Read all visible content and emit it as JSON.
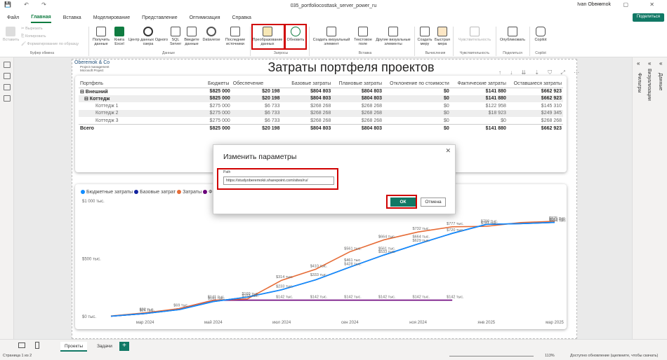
{
  "window": {
    "title": "035_portfoliocosttask_server_power_ru",
    "user": "Ivan Oberemok",
    "controls": "— ▢ ✕",
    "quick_access": "💾 ↶ ↷"
  },
  "menu": {
    "items": [
      "Файл",
      "Главная",
      "Вставка",
      "Моделирование",
      "Представление",
      "Оптимизация",
      "Справка"
    ],
    "share": "Поделиться"
  },
  "ribbon": {
    "buttons": {
      "paste": "Вставить",
      "cut": "Вырезать",
      "copy": "Копировать",
      "format": "Форматирование по образцу",
      "get_data": "Получить данные",
      "excel": "Книга Excel",
      "datahub": "Центр данных Одного озера",
      "sql": "SQL Server",
      "enter_data": "Введите данные",
      "dataverse": "Dataverse",
      "recent": "Последние источники",
      "transform": "Преобразование данных",
      "refresh": "Обновить",
      "new_visual": "Создать визуальный элемент",
      "textbox": "Текстовое поле",
      "more_visuals": "Другие визуальные элементы",
      "new_measure": "Создать меру",
      "quick_measure": "Быстрая мера",
      "sensitivity": "Чувствительность",
      "publish": "Опубликовать",
      "copilot": "Copilot"
    },
    "groups": {
      "clipboard": "Буфер обмена",
      "data": "Данные",
      "queries": "Запросы",
      "insert": "Вставка",
      "calculations": "Вычисления",
      "sensitivity": "Чувствительность",
      "share": "Поделиться",
      "copilot": "Copilot"
    }
  },
  "panes": {
    "filters": "Фильтры",
    "visualizations": "Визуализации",
    "data": "Данные"
  },
  "report": {
    "logo": {
      "company": "Oberemok & Co",
      "line1": "Project management",
      "line2": "Microsoft Project"
    },
    "title": "Затраты портфеля проектов",
    "visual_icons": "↑ ↓ ⇊ ⇣ ⛉ ⤢ ⋯"
  },
  "table": {
    "headers": [
      "Портфель",
      "Бюджеты",
      "Обеспечение",
      "Базовые затраты",
      "Плановые затраты",
      "Отклонение по стоимости",
      "Фактические затраты",
      "Оставшиеся затраты"
    ],
    "rows": [
      {
        "label": "⊟ Внешний",
        "cells": [
          "$825 000",
          "$20 198",
          "$804 803",
          "$804 803",
          "$0",
          "$141 880",
          "$662 923"
        ],
        "style": "bold"
      },
      {
        "label": "⊟ Коттедж",
        "cells": [
          "$825 000",
          "$20 198",
          "$804 803",
          "$804 803",
          "$0",
          "$141 880",
          "$662 923"
        ],
        "style": "bold shade"
      },
      {
        "label": "Коттедж 1",
        "cells": [
          "$275 000",
          "$6 733",
          "$268 268",
          "$268 268",
          "$0",
          "$122 958",
          "$145 310"
        ],
        "style": "sub"
      },
      {
        "label": "Коттедж 2",
        "cells": [
          "$275 000",
          "$6 733",
          "$268 268",
          "$268 268",
          "$0",
          "$18 923",
          "$249 345"
        ],
        "style": "sub shade"
      },
      {
        "label": "Коттедж 3",
        "cells": [
          "$275 000",
          "$6 733",
          "$268 268",
          "$268 268",
          "$0",
          "$0",
          "$268 268"
        ],
        "style": "sub"
      },
      {
        "label": "Всего",
        "cells": [
          "$825 000",
          "$20 198",
          "$804 803",
          "$804 803",
          "$0",
          "$141 880",
          "$662 923"
        ],
        "style": "bold total"
      }
    ]
  },
  "dialog": {
    "title": "Изменить параметры",
    "close": "✕",
    "param_label": "Path",
    "param_value": "https://studyoberemokii.sharepoint.com/sites/ru/",
    "ok": "ОК",
    "cancel": "Отмена"
  },
  "tabs": {
    "pages": [
      "Проекты",
      "Задачи"
    ],
    "add": "+"
  },
  "status": {
    "page": "Страница 1 из 2",
    "zoom": "113%",
    "update": "Доступно обновление (щелкните, чтобы скачать)"
  },
  "colors": {
    "accent": "#117865",
    "blue": "#118dff",
    "navy": "#12239e",
    "orange": "#e66c37",
    "purple": "#6b007b",
    "highlight": "#d00000"
  },
  "chart_data": {
    "type": "line",
    "x": [
      "фев 2024",
      "мар 2024",
      "апр 2024",
      "май 2024",
      "июн 2024",
      "июл 2024",
      "авг 2024",
      "сен 2024",
      "окт 2024",
      "ноя 2024",
      "дек 2024",
      "янв 2025",
      "фев 2025",
      "мар 2025"
    ],
    "x_tick_labels": [
      "мар 2024",
      "май 2024",
      "июл 2024",
      "сен 2024",
      "ноя 2024",
      "янв 2025",
      "мар 2025"
    ],
    "y_tick_labels": [
      "$0 тыс.",
      "$500 тыс.",
      "$1 000 тыс."
    ],
    "ylim": [
      0,
      1000
    ],
    "legend": [
      "Бюджетные затраты",
      "Базовые затрат",
      "Затраты",
      "Ф"
    ],
    "series": [
      {
        "name": "Бюджетные затраты",
        "color": "#118dff",
        "values": [
          3,
          26,
          60,
          130,
          169,
          232,
          318,
          428,
          533,
          629,
          720,
          798,
          804,
          815
        ]
      },
      {
        "name": "Базовые затрат",
        "color": "#12239e",
        "values": [
          3,
          26,
          60,
          130,
          169,
          232,
          318,
          428,
          533,
          629,
          720,
          798,
          804,
          815
        ]
      },
      {
        "name": "Затраты",
        "color": "#e66c37",
        "values": [
          5,
          32,
          69,
          141,
          153,
          314,
          410,
          561,
          664,
          732,
          777,
          781,
          813,
          825
        ]
      },
      {
        "name": "Ф",
        "color": "#6b007b",
        "values": [
          3,
          26,
          69,
          141,
          142,
          142,
          142,
          142,
          142,
          142,
          142
        ]
      }
    ],
    "data_labels": [
      {
        "x": 1,
        "y": 32,
        "text": "$32 тыс."
      },
      {
        "x": 1,
        "y": 26,
        "text": "$26 тыс."
      },
      {
        "x": 2,
        "y": 69,
        "text": "$69 тыс."
      },
      {
        "x": 3,
        "y": 141,
        "text": "$141 тыс."
      },
      {
        "x": 3,
        "y": 130,
        "text": "$141 тыс."
      },
      {
        "x": 4,
        "y": 153,
        "text": "$153 тыс."
      },
      {
        "x": 4,
        "y": 169,
        "text": "$169 тыс."
      },
      {
        "x": 5,
        "y": 314,
        "text": "$314 тыс."
      },
      {
        "x": 5,
        "y": 232,
        "text": "$233 тыс."
      },
      {
        "x": 5,
        "y": 142,
        "text": "$142 тыс."
      },
      {
        "x": 6,
        "y": 410,
        "text": "$410 тыс."
      },
      {
        "x": 6,
        "y": 333,
        "text": "$333 тыс."
      },
      {
        "x": 6,
        "y": 142,
        "text": "$142 тыс."
      },
      {
        "x": 7,
        "y": 561,
        "text": "$561 тыс."
      },
      {
        "x": 7,
        "y": 461,
        "text": "$461 тыс."
      },
      {
        "x": 7,
        "y": 428,
        "text": "$428 тыс."
      },
      {
        "x": 7,
        "y": 142,
        "text": "$142 тыс."
      },
      {
        "x": 8,
        "y": 664,
        "text": "$664 тыс."
      },
      {
        "x": 8,
        "y": 561,
        "text": "$561 тыс."
      },
      {
        "x": 8,
        "y": 533,
        "text": "$533 тыс."
      },
      {
        "x": 8,
        "y": 142,
        "text": "$142 тыс."
      },
      {
        "x": 9,
        "y": 732,
        "text": "$732 тыс."
      },
      {
        "x": 9,
        "y": 664,
        "text": "$664 тыс."
      },
      {
        "x": 9,
        "y": 629,
        "text": "$629 тыс."
      },
      {
        "x": 9,
        "y": 142,
        "text": "$142 тыс."
      },
      {
        "x": 10,
        "y": 777,
        "text": "$777 тыс."
      },
      {
        "x": 10,
        "y": 720,
        "text": "$720 тыс."
      },
      {
        "x": 10,
        "y": 142,
        "text": "$142 тыс."
      },
      {
        "x": 11,
        "y": 781,
        "text": "$781 тыс."
      },
      {
        "x": 11,
        "y": 798,
        "text": "$798 тыс."
      },
      {
        "x": 13,
        "y": 813,
        "text": "$813 тыс."
      },
      {
        "x": 13,
        "y": 825,
        "text": "$825 тыс."
      },
      {
        "x": 13,
        "y": 804,
        "text": "$804 тыс."
      }
    ]
  }
}
